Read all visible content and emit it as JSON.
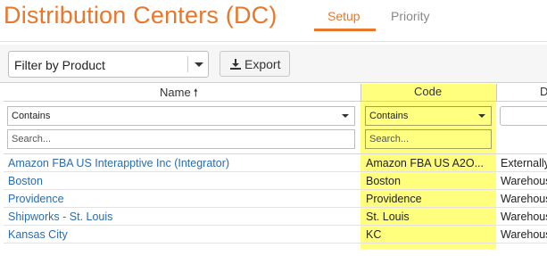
{
  "page": {
    "title": "Distribution Centers (DC)"
  },
  "tabs": [
    {
      "label": "Setup",
      "active": true
    },
    {
      "label": "Priority",
      "active": false
    }
  ],
  "toolbar": {
    "product_filter": "Filter by Product",
    "export_label": "Export"
  },
  "grid": {
    "columns": [
      {
        "label": "Name",
        "sort": "ascending"
      },
      {
        "label": "Code"
      },
      {
        "label": "D"
      }
    ],
    "filter": {
      "condition": "Contains",
      "search_placeholder": "Search..."
    },
    "rows": [
      {
        "name": "Amazon FBA US Interapptive Inc (Integrator)",
        "code": "Amazon FBA US A2O...",
        "desc": "Externally"
      },
      {
        "name": "Boston",
        "code": "Boston",
        "desc": "Warehouse"
      },
      {
        "name": "Providence",
        "code": "Providence",
        "desc": "Warehouse"
      },
      {
        "name": "Shipworks - St. Louis",
        "code": "St. Louis",
        "desc": "Warehouse"
      },
      {
        "name": "Kansas City",
        "code": "KC",
        "desc": "Warehouse"
      }
    ]
  },
  "colors": {
    "accent": "#e8762b",
    "link": "#2a6cae",
    "highlight": "#ffff66"
  }
}
